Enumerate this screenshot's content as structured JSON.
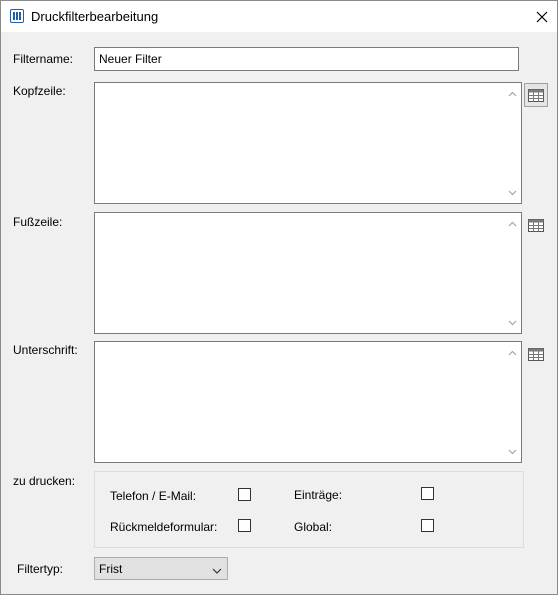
{
  "window": {
    "title": "Druckfilterbearbeitung",
    "icon": "app-columns-icon"
  },
  "fields": {
    "filtername_label": "Filtername:",
    "filtername_value": "Neuer Filter",
    "kopfzeile_label": "Kopfzeile:",
    "fusszeile_label": "Fußzeile:",
    "unterschrift_label": "Unterschrift:"
  },
  "print": {
    "label": "zu drucken:",
    "options": [
      {
        "label": "Telefon / E-Mail:",
        "checked": false
      },
      {
        "label": "Einträge:",
        "checked": false
      },
      {
        "label": "Rückmeldeformular:",
        "checked": false
      },
      {
        "label": "Global:",
        "checked": false
      }
    ]
  },
  "filtertyp": {
    "label": "Filtertyp:",
    "selected": "Frist"
  }
}
